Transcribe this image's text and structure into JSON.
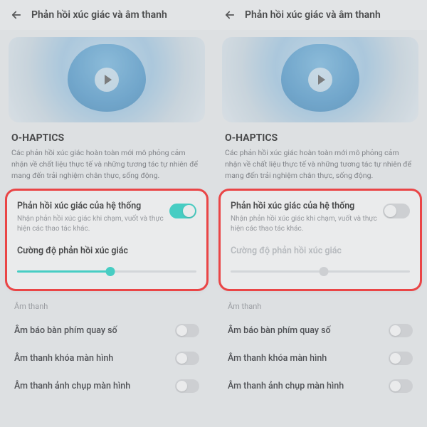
{
  "left": {
    "header_title": "Phản hồi xúc giác và âm thanh",
    "brand": "O-HAPTICS",
    "brand_desc": "Các phản hồi xúc giác hoàn toàn mới mô phỏng cảm nhận về chất liệu thực tế và những tương tác tự nhiên để mang đến trải nghiệm chân thực, sống động.",
    "system_haptic_title": "Phản hồi xúc giác của hệ thống",
    "system_haptic_sub": "Nhận phản hồi xúc giác khi chạm, vuốt và thực hiện các thao tác khác.",
    "system_haptic_on": true,
    "intensity_label": "Cường độ phản hồi xúc giác",
    "slider_percent": 52,
    "sound_header": "Âm thanh",
    "items": [
      {
        "label": "Âm báo bàn phím quay số",
        "on": false
      },
      {
        "label": "Âm thanh khóa màn hình",
        "on": false
      },
      {
        "label": "Âm thanh ảnh chụp màn hình",
        "on": false
      }
    ]
  },
  "right": {
    "header_title": "Phản hồi xúc giác và âm thanh",
    "brand": "O-HAPTICS",
    "brand_desc": "Các phản hồi xúc giác hoàn toàn mới mô phỏng cảm nhận về chất liệu thực tế và những tương tác tự nhiên để mang đến trải nghiệm chân thực, sống động.",
    "system_haptic_title": "Phản hồi xúc giác của hệ thống",
    "system_haptic_sub": "Nhận phản hồi xúc giác khi chạm, vuốt và thực hiện các thao tác khác.",
    "system_haptic_on": false,
    "intensity_label": "Cường độ phản hồi xúc giác",
    "slider_percent": 52,
    "sound_header": "Âm thanh",
    "items": [
      {
        "label": "Âm báo bàn phím quay số",
        "on": false
      },
      {
        "label": "Âm thanh khóa màn hình",
        "on": false
      },
      {
        "label": "Âm thanh ảnh chụp màn hình",
        "on": false
      }
    ]
  }
}
